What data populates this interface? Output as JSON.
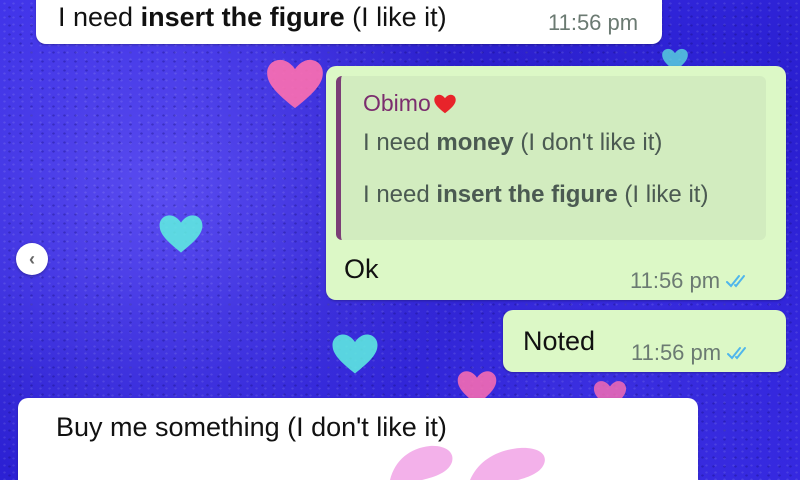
{
  "messages": {
    "top_incoming": {
      "text_before": "I need ",
      "text_bold": "insert the figure",
      "text_after": " (I like it)",
      "time": "11:56 pm"
    },
    "reply_outgoing": {
      "quote": {
        "author": "Obimo",
        "line1_before": "I need ",
        "line1_bold": "money",
        "line1_after": " (I don't like it)",
        "line2_before": "I need ",
        "line2_bold": "insert the figure",
        "line2_after": " (I like it)"
      },
      "text": "Ok",
      "time": "11:56 pm",
      "status": "read"
    },
    "noted_outgoing": {
      "text": "Noted",
      "time": "11:56 pm",
      "status": "read"
    },
    "bottom_incoming": {
      "text": "Buy me something (I don't like it)"
    }
  },
  "icons": {
    "nav": "chevron-left-icon",
    "ticks": "double-check-icon",
    "heart": "red-heart-emoji"
  },
  "colors": {
    "outgoing_bubble": "#dcf8c6",
    "incoming_bubble": "#ffffff",
    "read_ticks": "#4fb6ec",
    "quote_bar": "#7b3e76",
    "quote_author": "#7b2d6e",
    "wallpaper": "#2b1fd6"
  },
  "nav": {
    "prev_label": "‹"
  }
}
